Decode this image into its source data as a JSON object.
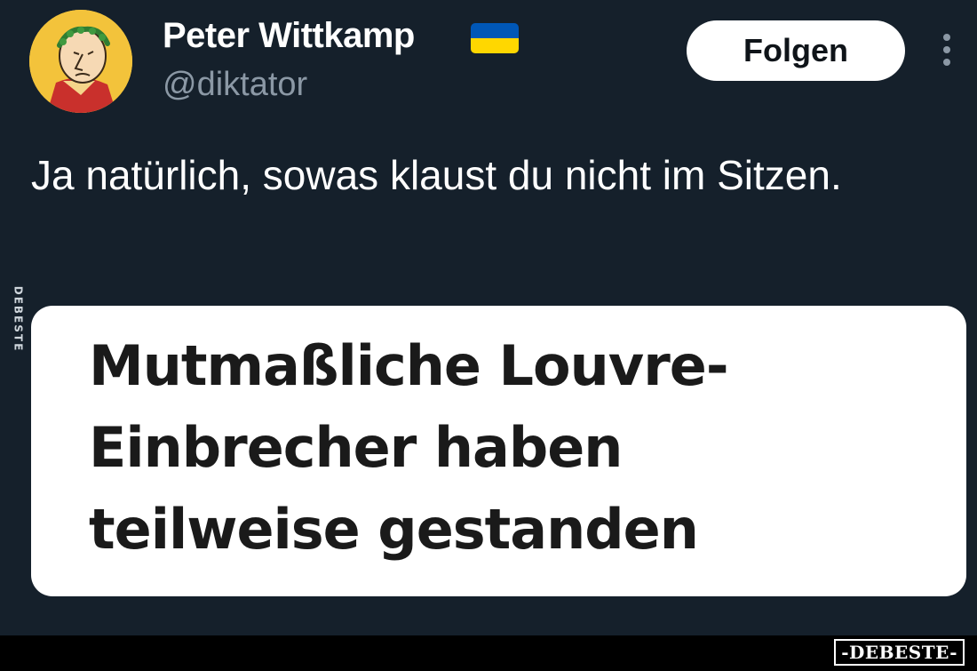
{
  "tweet": {
    "author": {
      "display_name": "Peter Wittkamp",
      "handle": "@diktator",
      "flag": "ukraine-flag",
      "flag_colors": {
        "top": "#0057b7",
        "bottom": "#ffd700"
      }
    },
    "follow_label": "Folgen",
    "more_icon": "more-vertical-icon",
    "text": "Ja natürlich, sowas klaust du nicht im Sitzen.",
    "media": {
      "headline": "Mutmaßliche Louvre-Einbrecher haben teilweise gestanden"
    }
  },
  "watermarks": {
    "side": "DEBESTE",
    "footer": "-DEBESTE-"
  },
  "colors": {
    "background": "#15202b",
    "secondary_text": "#8b98a5",
    "button_bg": "#ffffff",
    "button_text": "#0f1419"
  }
}
